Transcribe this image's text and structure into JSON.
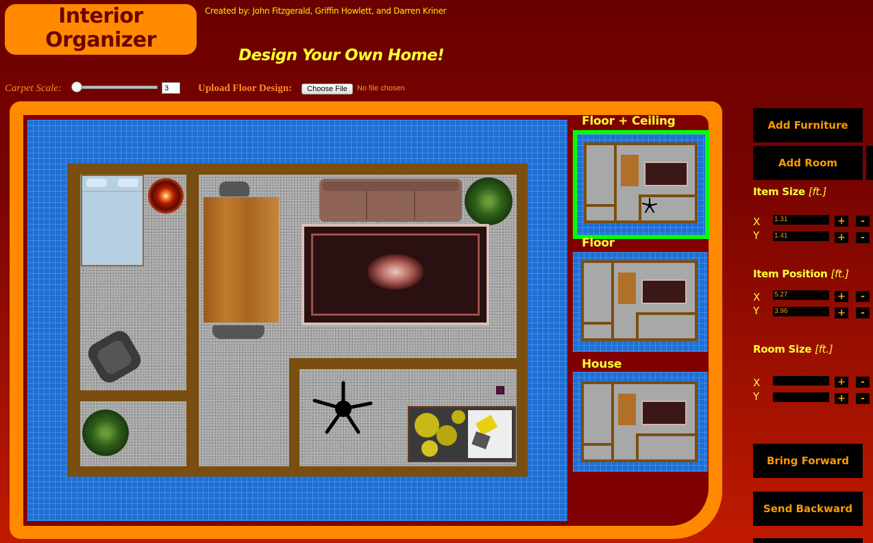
{
  "header": {
    "logo": "Interior Organizer",
    "credits": "Created by: John Fitzgerald, Griffin Howlett, and Darren Kriner",
    "tagline": "Design Your Own Home!"
  },
  "controls": {
    "carpet_scale_label": "Carpet Scale:",
    "carpet_scale_value": "3",
    "upload_label": "Upload Floor Design:",
    "choose_file": "Choose File",
    "file_status": "No file chosen"
  },
  "previews": {
    "floor_ceiling": "Floor + Ceiling",
    "floor": "Floor",
    "house": "House",
    "selected": "floor_ceiling"
  },
  "sidebar": {
    "add_furniture": "Add Furniture",
    "add_room": "Add Room",
    "item_size": {
      "title": "Item Size",
      "unit": "[ft.]",
      "x_label": "X",
      "y_label": "Y",
      "x": "1.31",
      "y": "1.41"
    },
    "item_position": {
      "title": "Item Position",
      "unit": "[ft.]",
      "x_label": "X",
      "y_label": "Y",
      "x": "5.27",
      "y": "3.96"
    },
    "room_size": {
      "title": "Room Size",
      "unit": "[ft.]",
      "x_label": "X",
      "y_label": "Y",
      "x": "",
      "y": ""
    },
    "plus": "+",
    "minus": "-",
    "bring_forward": "Bring Forward",
    "send_backward": "Send Backward"
  },
  "colors": {
    "background": "#7a0400",
    "accent": "#ff8a00",
    "highlight": "#ffff33",
    "blueprint": "#1f6fd4",
    "wall": "#7a4e10",
    "selected_border": "#00ff00"
  }
}
